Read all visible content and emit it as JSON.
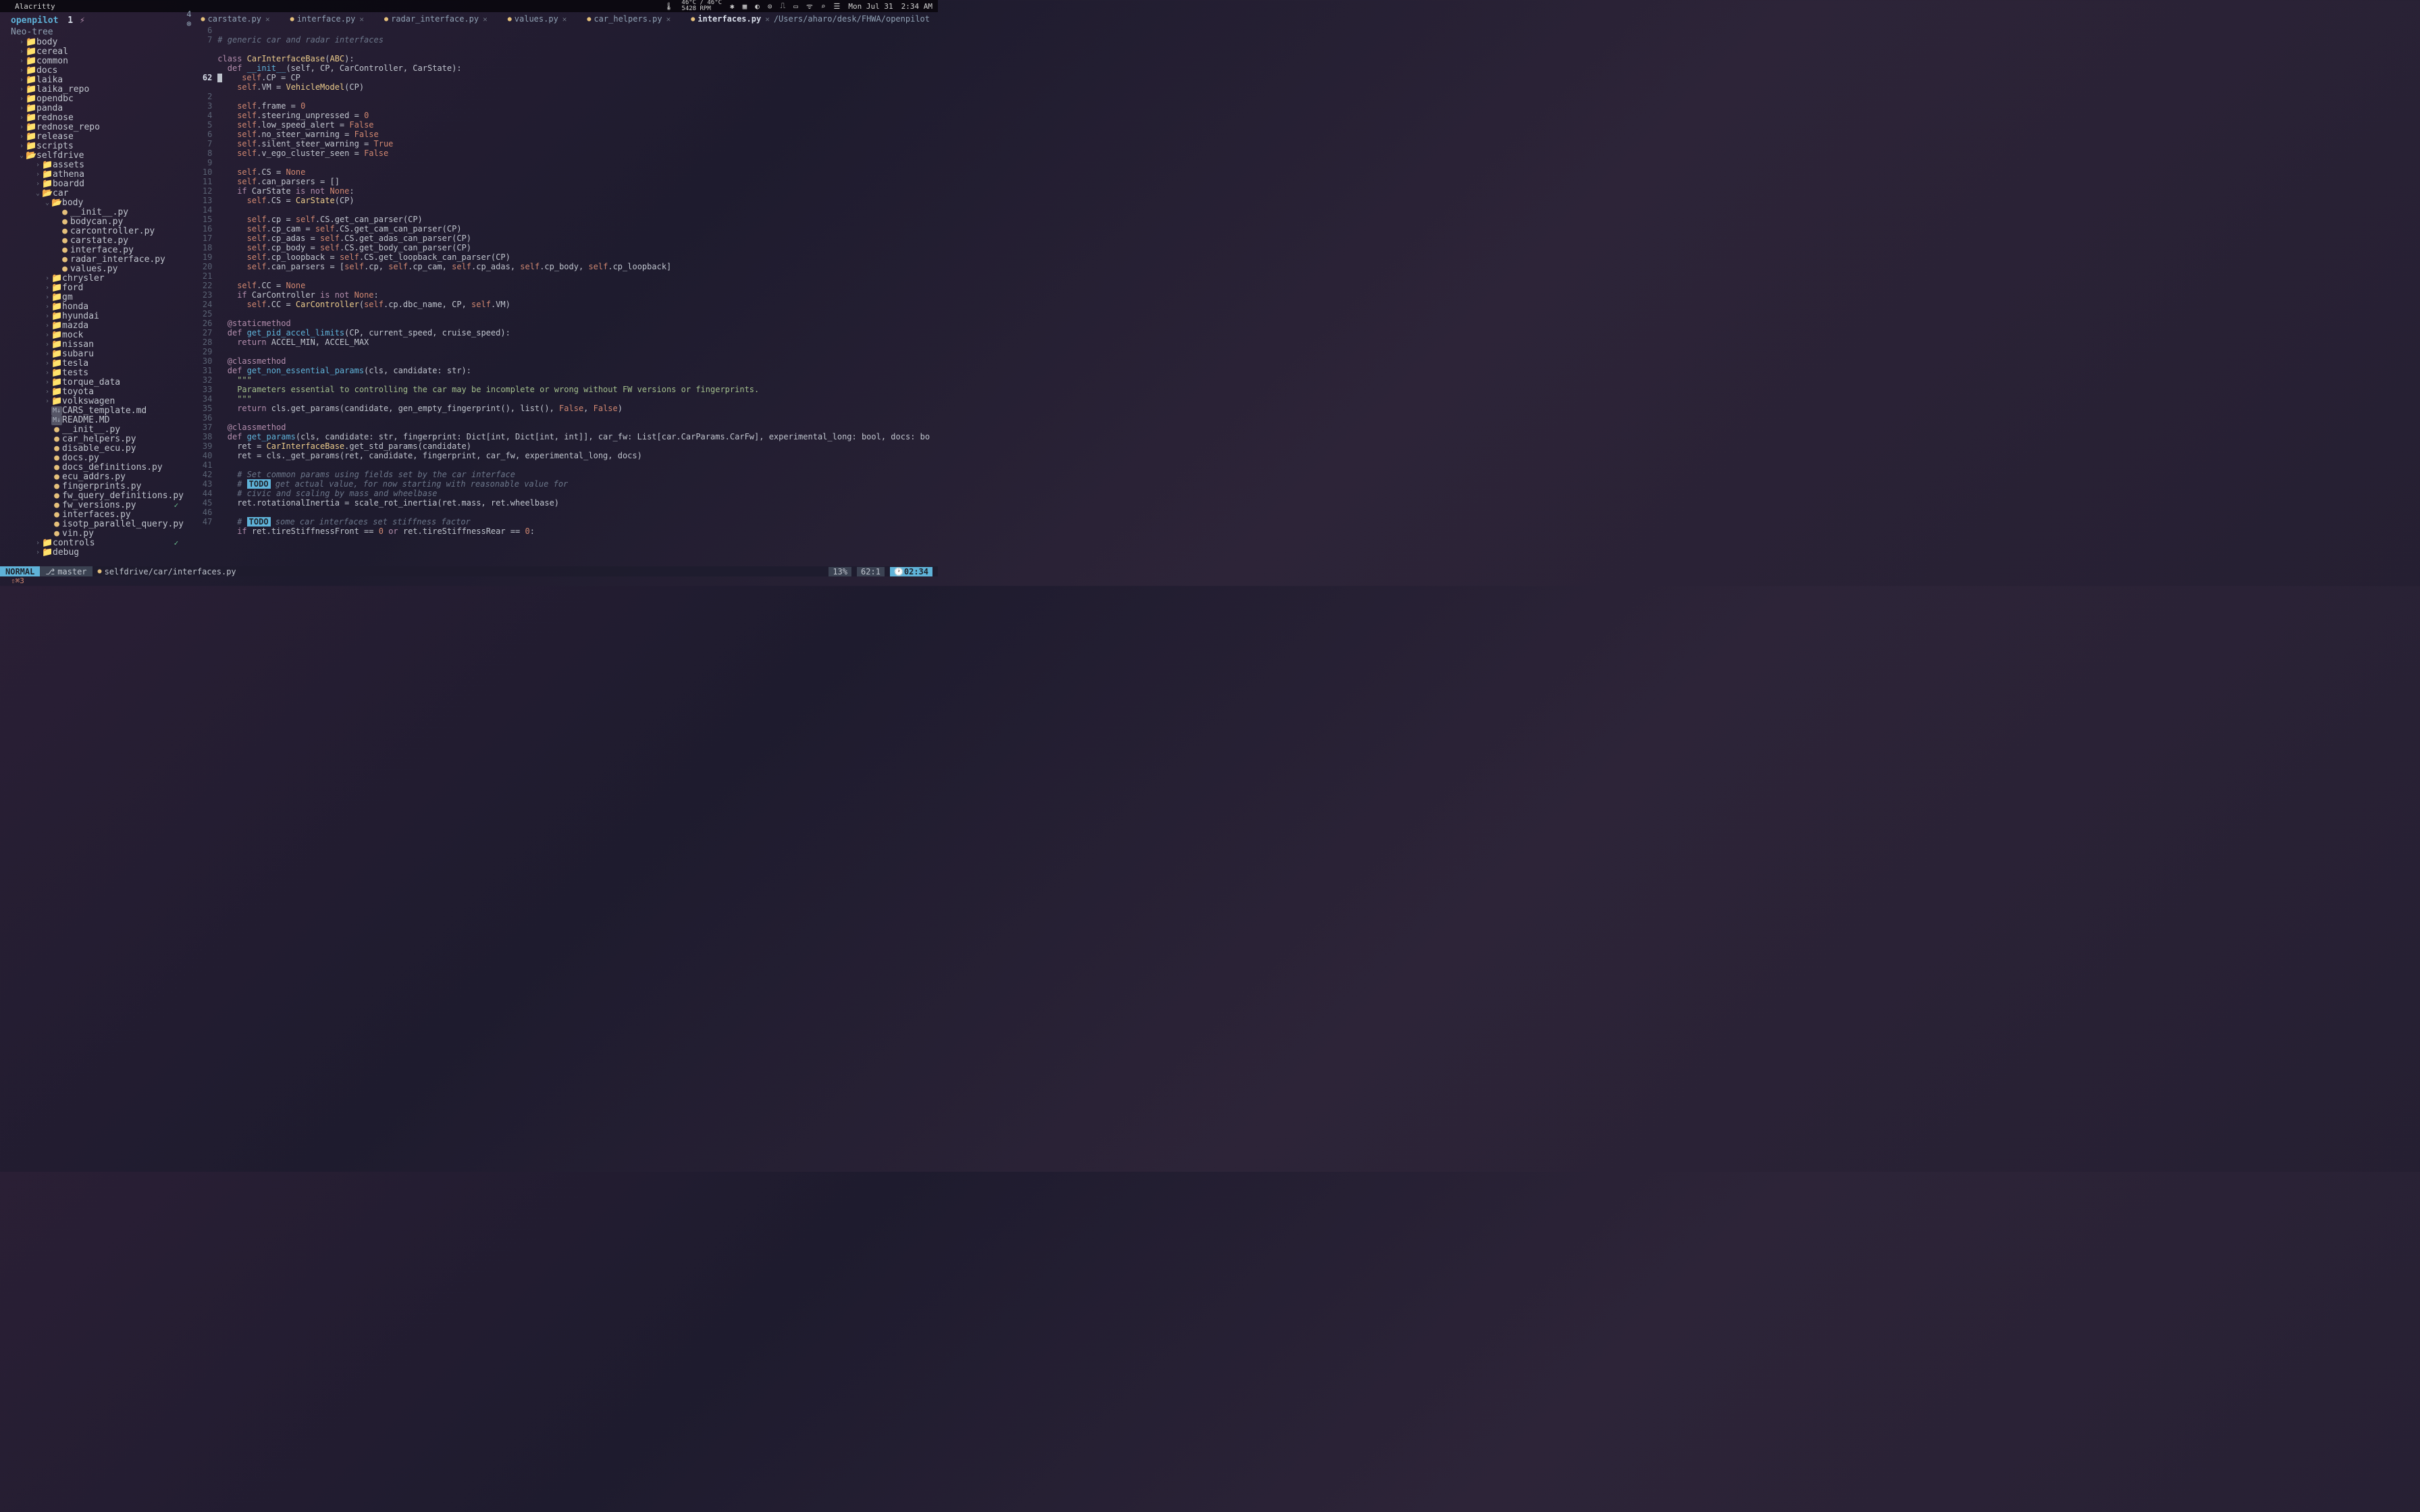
{
  "menubar": {
    "app_name": "Alacritty",
    "temp_line1": "46°C / 46°C",
    "temp_line2": "5428 RPM",
    "date": "Mon Jul 31",
    "time": "2:34 AM"
  },
  "project": {
    "name": "openpilot",
    "indicator_num": "1",
    "path": "/Users/aharo/desk/FHWA/openpilot"
  },
  "tree_header": "Neo-tree",
  "sidebar": {
    "folders_top": [
      {
        "name": "body",
        "chev": "›"
      },
      {
        "name": "cereal",
        "chev": "›"
      },
      {
        "name": "common",
        "chev": "›"
      },
      {
        "name": "docs",
        "chev": "›"
      },
      {
        "name": "laika",
        "chev": "›"
      },
      {
        "name": "laika_repo",
        "chev": "›"
      },
      {
        "name": "opendbc",
        "chev": "›"
      },
      {
        "name": "panda",
        "chev": "›"
      },
      {
        "name": "rednose",
        "chev": "›"
      },
      {
        "name": "rednose_repo",
        "chev": "›"
      },
      {
        "name": "release",
        "chev": "›"
      },
      {
        "name": "scripts",
        "chev": "›"
      }
    ],
    "selfdrive": {
      "name": "selfdrive",
      "chev": "⌄"
    },
    "selfdrive_children": [
      {
        "name": "assets",
        "chev": "›"
      },
      {
        "name": "athena",
        "chev": "›"
      },
      {
        "name": "boardd",
        "chev": "›"
      }
    ],
    "car": {
      "name": "car",
      "chev": "⌄"
    },
    "body": {
      "name": "body",
      "chev": "⌄"
    },
    "body_files": [
      {
        "name": "__init__.py"
      },
      {
        "name": "bodycan.py"
      },
      {
        "name": "carcontroller.py"
      },
      {
        "name": "carstate.py"
      },
      {
        "name": "interface.py"
      },
      {
        "name": "radar_interface.py"
      },
      {
        "name": "values.py"
      }
    ],
    "car_folders": [
      {
        "name": "chrysler"
      },
      {
        "name": "ford"
      },
      {
        "name": "gm"
      },
      {
        "name": "honda"
      },
      {
        "name": "hyundai"
      },
      {
        "name": "mazda"
      },
      {
        "name": "mock"
      },
      {
        "name": "nissan"
      },
      {
        "name": "subaru"
      },
      {
        "name": "tesla"
      },
      {
        "name": "tests"
      },
      {
        "name": "torque_data"
      },
      {
        "name": "toyota"
      },
      {
        "name": "volkswagen"
      }
    ],
    "car_files": [
      {
        "name": "CARS_template.md",
        "icon": "md"
      },
      {
        "name": "README.MD",
        "icon": "md"
      },
      {
        "name": "__init__.py",
        "icon": "py"
      },
      {
        "name": "car_helpers.py",
        "icon": "py"
      },
      {
        "name": "disable_ecu.py",
        "icon": "py"
      },
      {
        "name": "docs.py",
        "icon": "py"
      },
      {
        "name": "docs_definitions.py",
        "icon": "py"
      },
      {
        "name": "ecu_addrs.py",
        "icon": "py"
      },
      {
        "name": "fingerprints.py",
        "icon": "py"
      },
      {
        "name": "fw_query_definitions.py",
        "icon": "py"
      },
      {
        "name": "fw_versions.py",
        "icon": "py",
        "status": "✓"
      },
      {
        "name": "interfaces.py",
        "icon": "py"
      },
      {
        "name": "isotp_parallel_query.py",
        "icon": "py"
      },
      {
        "name": "vin.py",
        "icon": "py"
      }
    ],
    "controls": {
      "name": "controls",
      "status": "✓"
    },
    "debug": {
      "name": "debug"
    }
  },
  "tabs": {
    "lead": "4 ⊗",
    "items": [
      {
        "label": "carstate.py",
        "modified": true
      },
      {
        "label": "interface.py",
        "modified": true
      },
      {
        "label": "radar_interface.py",
        "modified": true
      },
      {
        "label": "values.py",
        "modified": true
      },
      {
        "label": "car_helpers.py",
        "modified": true
      },
      {
        "label": "interfaces.py",
        "modified": true,
        "active": true
      }
    ]
  },
  "gutter": [
    "6",
    "7",
    "",
    "",
    "",
    "62",
    "",
    "2",
    "3",
    "4",
    "5",
    "6",
    "7",
    "8",
    "9",
    "10",
    "11",
    "12",
    "13",
    "14",
    "15",
    "16",
    "17",
    "18",
    "19",
    "20",
    "21",
    "22",
    "23",
    "24",
    "25",
    "26",
    "27",
    "28",
    "29",
    "30",
    "31",
    "32",
    "33",
    "34",
    "35",
    "36",
    "37",
    "38",
    "39",
    "40",
    "41",
    "42",
    "43",
    "44",
    "45",
    "46",
    "47"
  ],
  "gutter_current_index": 5,
  "code_lines": [
    {
      "t": "blank"
    },
    {
      "t": "comment",
      "text": "# generic car and radar interfaces"
    },
    {
      "t": "blank"
    },
    {
      "t": "classdef",
      "text_pre": "class ",
      "cls": "CarInterfaceBase",
      "text_post": "(",
      "param": "ABC",
      "end": "):"
    },
    {
      "t": "funcdef",
      "indent": "  ",
      "kw": "def ",
      "fn": "__init__",
      "args": "(self, CP, CarController, CarState):"
    },
    {
      "t": "assign_cursor",
      "indent": "    ",
      "lhs": "self.CP",
      "rhs": " = CP"
    },
    {
      "t": "assign",
      "indent": "    ",
      "lhs": "self.VM",
      "rhs": " = VehicleModel(CP)"
    },
    {
      "t": "blank"
    },
    {
      "t": "assign",
      "indent": "    ",
      "lhs": "self.frame",
      "rhs": " = 0"
    },
    {
      "t": "assign",
      "indent": "    ",
      "lhs": "self.steering_unpressed",
      "rhs": " = 0"
    },
    {
      "t": "assign",
      "indent": "    ",
      "lhs": "self.low_speed_alert",
      "rhs": " = False"
    },
    {
      "t": "assign",
      "indent": "    ",
      "lhs": "self.no_steer_warning",
      "rhs": " = False"
    },
    {
      "t": "assign",
      "indent": "    ",
      "lhs": "self.silent_steer_warning",
      "rhs": " = True"
    },
    {
      "t": "assign",
      "indent": "    ",
      "lhs": "self.v_ego_cluster_seen",
      "rhs": " = False"
    },
    {
      "t": "blank"
    },
    {
      "t": "assign",
      "indent": "    ",
      "lhs": "self.CS",
      "rhs": " = None"
    },
    {
      "t": "assign",
      "indent": "    ",
      "lhs": "self.can_parsers",
      "rhs": " = []"
    },
    {
      "t": "if",
      "indent": "    ",
      "cond": "CarState is not None:"
    },
    {
      "t": "assign",
      "indent": "      ",
      "lhs": "self.CS",
      "rhs": " = CarState(CP)"
    },
    {
      "t": "blank"
    },
    {
      "t": "assign",
      "indent": "      ",
      "lhs": "self.cp",
      "rhs": " = self.CS.get_can_parser(CP)"
    },
    {
      "t": "assign",
      "indent": "      ",
      "lhs": "self.cp_cam",
      "rhs": " = self.CS.get_cam_can_parser(CP)"
    },
    {
      "t": "assign",
      "indent": "      ",
      "lhs": "self.cp_adas",
      "rhs": " = self.CS.get_adas_can_parser(CP)"
    },
    {
      "t": "assign",
      "indent": "      ",
      "lhs": "self.cp_body",
      "rhs": " = self.CS.get_body_can_parser(CP)"
    },
    {
      "t": "assign",
      "indent": "      ",
      "lhs": "self.cp_loopback",
      "rhs": " = self.CS.get_loopback_can_parser(CP)"
    },
    {
      "t": "assign",
      "indent": "      ",
      "lhs": "self.can_parsers",
      "rhs": " = [self.cp, self.cp_cam, self.cp_adas, self.cp_body, self.cp_loopback]"
    },
    {
      "t": "blank"
    },
    {
      "t": "assign",
      "indent": "    ",
      "lhs": "self.CC",
      "rhs": " = None"
    },
    {
      "t": "if",
      "indent": "    ",
      "cond": "CarController is not None:"
    },
    {
      "t": "assign",
      "indent": "      ",
      "lhs": "self.CC",
      "rhs": " = CarController(self.cp.dbc_name, CP, self.VM)"
    },
    {
      "t": "blank"
    },
    {
      "t": "deco",
      "indent": "  ",
      "text": "@staticmethod"
    },
    {
      "t": "funcdef",
      "indent": "  ",
      "kw": "def ",
      "fn": "get_pid_accel_limits",
      "args": "(CP, current_speed, cruise_speed):"
    },
    {
      "t": "return",
      "indent": "    ",
      "text": "return ACCEL_MIN, ACCEL_MAX"
    },
    {
      "t": "blank"
    },
    {
      "t": "deco",
      "indent": "  ",
      "text": "@classmethod"
    },
    {
      "t": "funcdef",
      "indent": "  ",
      "kw": "def ",
      "fn": "get_non_essential_params",
      "args": "(cls, candidate: str):"
    },
    {
      "t": "docstr",
      "indent": "    ",
      "text": "\"\"\""
    },
    {
      "t": "docstr",
      "indent": "    ",
      "text": "Parameters essential to controlling the car may be incomplete or wrong without FW versions or fingerprints."
    },
    {
      "t": "docstr",
      "indent": "    ",
      "text": "\"\"\""
    },
    {
      "t": "return",
      "indent": "    ",
      "text": "return cls.get_params(candidate, gen_empty_fingerprint(), list(), False, False)"
    },
    {
      "t": "blank"
    },
    {
      "t": "deco",
      "indent": "  ",
      "text": "@classmethod"
    },
    {
      "t": "funcdef",
      "indent": "  ",
      "kw": "def ",
      "fn": "get_params",
      "args": "(cls, candidate: str, fingerprint: Dict[int, Dict[int, int]], car_fw: List[car.CarParams.CarFw], experimental_long: bool, docs: bo"
    },
    {
      "t": "plain",
      "indent": "    ",
      "text": "ret = CarInterfaceBase.get_std_params(candidate)"
    },
    {
      "t": "plain",
      "indent": "    ",
      "text": "ret = cls._get_params(ret, candidate, fingerprint, car_fw, experimental_long, docs)"
    },
    {
      "t": "blank"
    },
    {
      "t": "comment",
      "indent": "    ",
      "text": "# Set common params using fields set by the car interface"
    },
    {
      "t": "todo",
      "indent": "    ",
      "pre": "# ",
      "todo": "TODO",
      "post": " get actual value, for now starting with reasonable value for"
    },
    {
      "t": "comment",
      "indent": "    ",
      "text": "# civic and scaling by mass and wheelbase"
    },
    {
      "t": "plain",
      "indent": "    ",
      "text": "ret.rotationalInertia = scale_rot_inertia(ret.mass, ret.wheelbase)"
    },
    {
      "t": "blank"
    },
    {
      "t": "todo",
      "indent": "    ",
      "pre": "# ",
      "todo": "TODO",
      "post": " some car interfaces set stiffness factor"
    },
    {
      "t": "if",
      "indent": "    ",
      "cond": "ret.tireStiffnessFront == 0 or ret.tireStiffnessRear == 0:"
    }
  ],
  "statusline": {
    "mode": "NORMAL",
    "branch": "master",
    "file": "selfdrive/car/interfaces.py",
    "percent": "13%",
    "position": "62:1",
    "clock": "02:34"
  },
  "keyhint": "⇧⌘3"
}
